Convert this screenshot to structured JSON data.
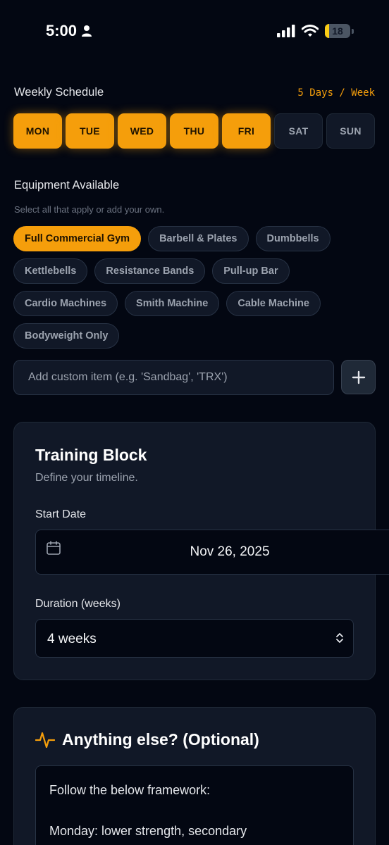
{
  "status_bar": {
    "time": "5:00",
    "battery": "18",
    "battery_level": 0.18
  },
  "schedule": {
    "title": "Weekly Schedule",
    "meta": "5 Days / Week",
    "days": [
      {
        "label": "MON",
        "selected": true
      },
      {
        "label": "TUE",
        "selected": true
      },
      {
        "label": "WED",
        "selected": true
      },
      {
        "label": "THU",
        "selected": true
      },
      {
        "label": "FRI",
        "selected": true
      },
      {
        "label": "SAT",
        "selected": false
      },
      {
        "label": "SUN",
        "selected": false
      }
    ]
  },
  "equipment": {
    "title": "Equipment Available",
    "hint": "Select all that apply or add your own.",
    "rows": [
      [
        {
          "label": "Full Commercial Gym",
          "selected": true
        },
        {
          "label": "Barbell & Plates",
          "selected": false
        },
        {
          "label": "Dumbbells",
          "selected": false
        }
      ],
      [
        {
          "label": "Kettlebells",
          "selected": false
        },
        {
          "label": "Resistance Bands",
          "selected": false
        },
        {
          "label": "Pull-up Bar",
          "selected": false
        }
      ],
      [
        {
          "label": "Cardio Machines",
          "selected": false
        },
        {
          "label": "Smith Machine",
          "selected": false
        },
        {
          "label": "Cable Machine",
          "selected": false
        }
      ],
      [
        {
          "label": "Bodyweight Only",
          "selected": false
        }
      ]
    ],
    "custom_placeholder": "Add custom item (e.g. 'Sandbag', 'TRX')",
    "custom_value": ""
  },
  "training_block": {
    "title": "Training Block",
    "subtitle": "Define your timeline.",
    "start_label": "Start Date",
    "start_value": "Nov 26, 2025",
    "duration_label": "Duration (weeks)",
    "duration_value": "4 weeks"
  },
  "notes": {
    "title": "Anything else? (Optional)",
    "text": "Follow the below framework:\n\nMonday: lower strength, secondary"
  },
  "colors": {
    "accent": "#f59e0b",
    "background": "#030712",
    "card": "#111827"
  },
  "icons": [
    "person-icon",
    "signal-icon",
    "wifi-icon",
    "battery-icon",
    "plus-icon",
    "calendar-icon",
    "chevron-updown-icon",
    "activity-icon"
  ]
}
